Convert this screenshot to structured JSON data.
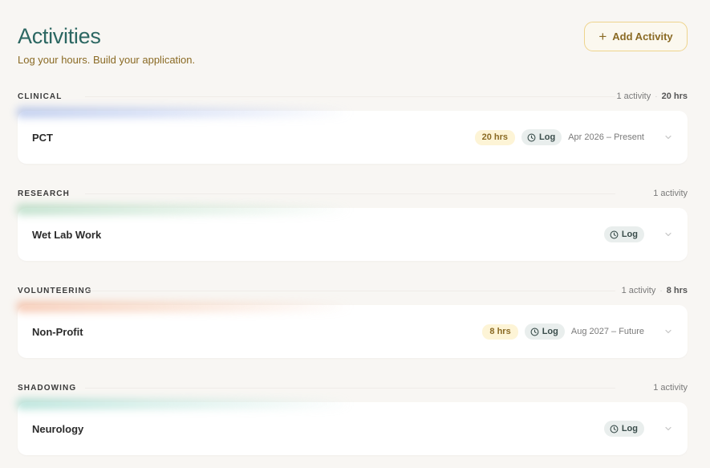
{
  "header": {
    "title": "Activities",
    "subtitle": "Log your hours. Build your application.",
    "add_button_label": "Add Activity"
  },
  "colors": {
    "title": "#2c6762",
    "accent_gold": "#8a6a24",
    "clinical": "#8fa7e0",
    "research": "#8fc9a5",
    "volunteering": "#f0a07a",
    "shadowing": "#7fcdbd"
  },
  "sections": [
    {
      "title": "CLINICAL",
      "count": "1 activity",
      "hours": "20 hrs",
      "activity": {
        "name": "PCT",
        "hours": "20 hrs",
        "log_label": "Log",
        "date_range": "Apr 2026 – Present"
      }
    },
    {
      "title": "RESEARCH",
      "count": "1 activity",
      "activity": {
        "name": "Wet Lab Work",
        "log_label": "Log"
      }
    },
    {
      "title": "VOLUNTEERING",
      "count": "1 activity",
      "hours": "8 hrs",
      "activity": {
        "name": "Non-Profit",
        "hours": "8 hrs",
        "log_label": "Log",
        "date_range": "Aug 2027 – Future"
      }
    },
    {
      "title": "SHADOWING",
      "count": "1 activity",
      "activity": {
        "name": "Neurology",
        "log_label": "Log"
      }
    }
  ],
  "icons": {
    "add": "plus-icon",
    "log": "clock-icon",
    "expand": "chevron-down-icon"
  }
}
